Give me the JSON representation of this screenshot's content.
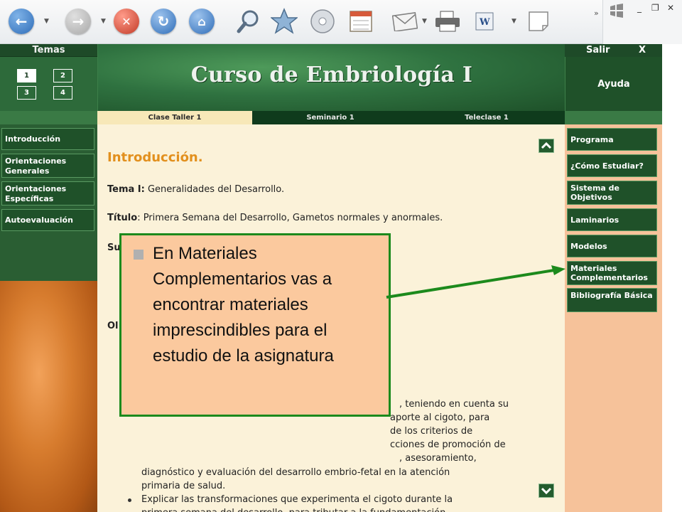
{
  "browser": {
    "icons": [
      "back-icon",
      "forward-icon",
      "stop-icon",
      "refresh-icon",
      "home-icon",
      "search-icon",
      "favorites-icon",
      "media-icon",
      "history-icon",
      "mail-icon",
      "print-icon",
      "edit-word-icon",
      "discuss-icon"
    ],
    "window_controls": {
      "minimize": "_",
      "restore": "❐",
      "close": "✕"
    }
  },
  "header": {
    "temas_label": "Temas",
    "topic_numbers": [
      "1",
      "2",
      "3",
      "4"
    ],
    "active_topic": "1",
    "course_title": "Curso de Embriología I",
    "salir_label": "Salir",
    "salir_x": "X",
    "ayuda_label": "Ayuda"
  },
  "tabs": [
    {
      "label": "Clase Taller 1",
      "active": true
    },
    {
      "label": "Seminario 1",
      "active": false
    },
    {
      "label": "Teleclase 1",
      "active": false
    }
  ],
  "left_nav": [
    {
      "label": "Introducción"
    },
    {
      "label": "Orientaciones Generales"
    },
    {
      "label": "Orientaciones Específicas"
    },
    {
      "label": "Autoevaluación"
    }
  ],
  "right_nav": [
    {
      "label": "Programa"
    },
    {
      "label": "¿Cómo Estudiar?"
    },
    {
      "label": "Sistema de Objetivos"
    },
    {
      "label": "Laminarios"
    },
    {
      "label": "Modelos"
    },
    {
      "label": "Materiales Complementarios"
    },
    {
      "label": "Bibliografía Básica"
    }
  ],
  "content": {
    "heading": "Introducción.",
    "tema_label": "Tema I:",
    "tema_value": "Generalidades del Desarrollo.",
    "titulo_label": "Título",
    "titulo_value": ": Primera Semana del Desarrollo, Gametos normales y anormales.",
    "su_fragment": "Su",
    "ol_fragment": "Ol",
    "partial_lines": [
      ", teniendo en cuenta su",
      "aporte al cigoto, para",
      "de los criterios de",
      "cciones de promoción de",
      ", asesoramiento,"
    ],
    "lines": [
      "diagnóstico y evaluación del desarrollo embrio-fetal en la atención",
      "primaria de salud.",
      "Explicar las transformaciones que experimenta el cigoto durante la",
      "primera semana del desarrollo, para tributar a la fundamentación"
    ]
  },
  "callout": {
    "text": "En Materiales Complementarios vas a encontrar materiales imprescindibles para el estudio de la asignatura",
    "border_color": "#1c8a1c",
    "background_color": "#fbc99e"
  },
  "colors": {
    "dark_green": "#1f5129",
    "banner_green": "#2f7240",
    "heading_orange": "#e2901e",
    "content_bg": "#fbf2d9",
    "right_panel_bg": "#f6c29a"
  }
}
